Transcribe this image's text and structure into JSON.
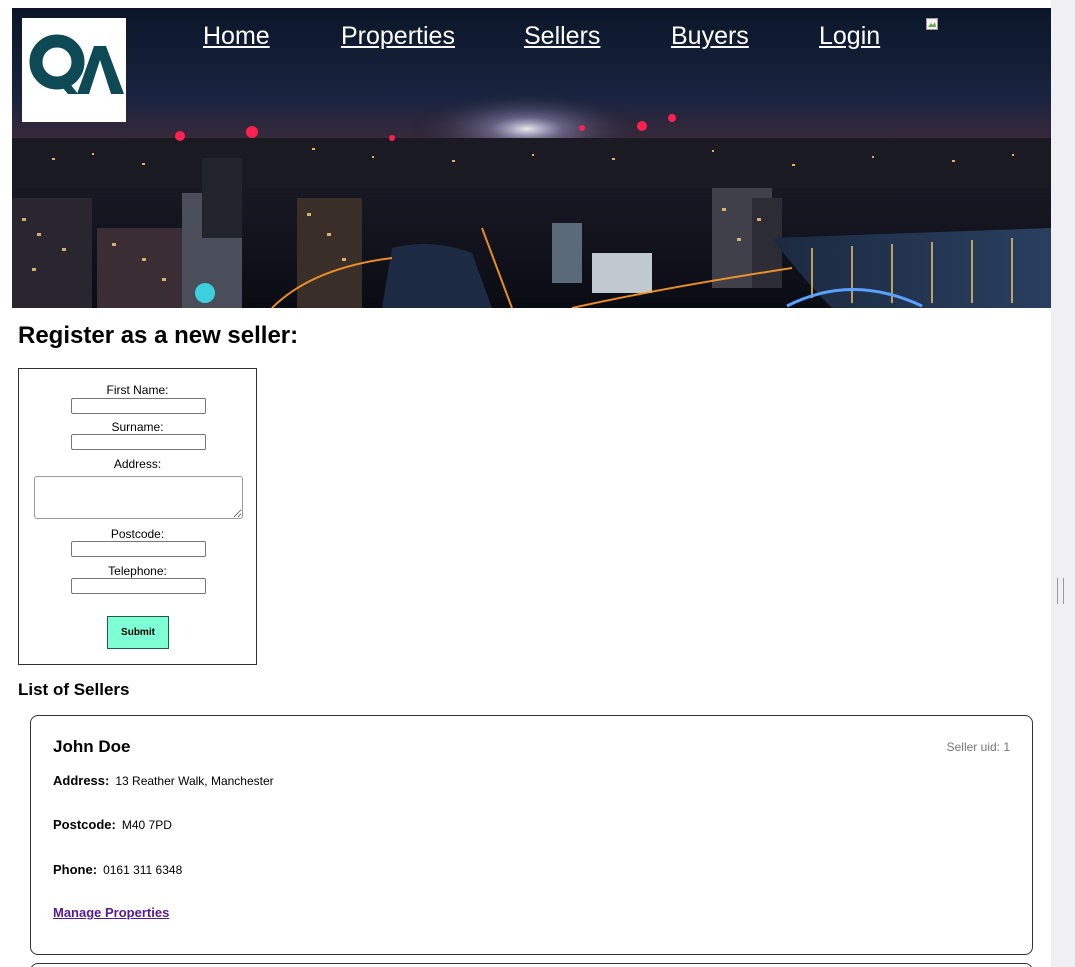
{
  "nav": {
    "links": [
      "Home",
      "Properties",
      "Sellers",
      "Buyers",
      "Login"
    ]
  },
  "page": {
    "title": "Register as a new seller:"
  },
  "form": {
    "first_name_label": "First Name:",
    "surname_label": "Surname:",
    "address_label": "Address:",
    "postcode_label": "Postcode:",
    "telephone_label": "Telephone:",
    "submit_label": "Submit",
    "submit_color": "#7fffd4"
  },
  "list": {
    "title": "List of Sellers",
    "sellers": [
      {
        "name": "John Doe",
        "uid_label": "Seller uid: 1",
        "address_key": "Address:",
        "address": "13 Reather Walk, Manchester",
        "postcode_key": "Postcode:",
        "postcode": "M40 7PD",
        "phone_key": "Phone:",
        "phone": "0161 311 6348",
        "manage_link": "Manage Properties"
      }
    ]
  },
  "colors": {
    "logo_mark": "#0e4a55",
    "link_visited": "#551a8b"
  }
}
